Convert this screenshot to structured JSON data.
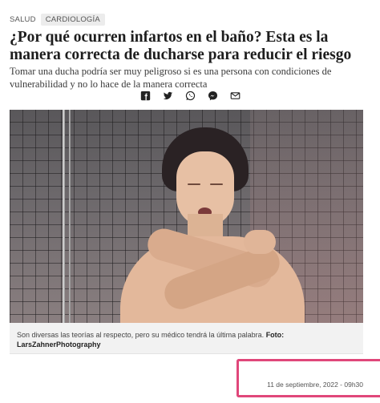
{
  "tags": {
    "section": "SALUD",
    "category": "CARDIOLOGÍA"
  },
  "article": {
    "title": "¿Por qué ocurren infartos en el baño? Esta es la manera correcta de ducharse para reducir el riesgo",
    "subtitle": "Tomar una ducha podría ser muy peligroso si es una persona con condiciones de vulnerabilidad y no lo hace de la manera correcta",
    "date": "11 de septiembre, 2022 - 09h30"
  },
  "share_icons": [
    "facebook-icon",
    "twitter-icon",
    "whatsapp-icon",
    "messenger-icon",
    "email-icon"
  ],
  "photo": {
    "caption": "Son diversas las teorías al respecto, pero su médico tendrá la última palabra.",
    "credit": "Foto: LarsZahnerPhotography"
  },
  "colors": {
    "highlight_border": "#e0477a",
    "caption_bg": "#f2f2f2"
  }
}
